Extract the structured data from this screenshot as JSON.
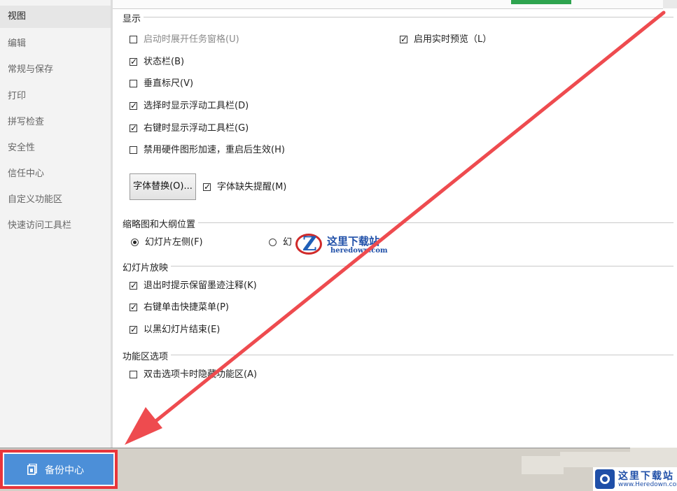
{
  "sidebar": {
    "items": [
      {
        "label": "视图",
        "active": true
      },
      {
        "label": "编辑"
      },
      {
        "label": "常规与保存"
      },
      {
        "label": "打印"
      },
      {
        "label": "拼写检查"
      },
      {
        "label": "安全性"
      },
      {
        "label": "信任中心"
      },
      {
        "label": "自定义功能区"
      },
      {
        "label": "快速访问工具栏"
      }
    ]
  },
  "sections": {
    "display": "显示",
    "thumbnail": "缩略图和大纲位置",
    "slideshow": "幻灯片放映",
    "ribbon": "功能区选项"
  },
  "options": {
    "startup_taskpane": {
      "label": "启动时展开任务窗格(U)",
      "checked": false,
      "disabled": true
    },
    "live_preview": {
      "label": "启用实时预览（L）",
      "checked": true
    },
    "status_bar": {
      "label": "状态栏(B)",
      "checked": true
    },
    "vertical_ruler": {
      "label": "垂直标尺(V)",
      "checked": false
    },
    "float_toolbar_select": {
      "label": "选择时显示浮动工具栏(D)",
      "checked": true
    },
    "float_toolbar_rightclick": {
      "label": "右键时显示浮动工具栏(G)",
      "checked": true
    },
    "disable_hw_accel": {
      "label": "禁用硬件图形加速，重启后生效(H)",
      "checked": false
    },
    "font_missing_alert": {
      "label": "字体缺失提醒(M)",
      "checked": true
    },
    "slides_left": {
      "label": "幻灯片左侧(F)",
      "selected": true
    },
    "slides_right_partial": {
      "label": "幻",
      "selected": false
    },
    "ink_prompt": {
      "label": "退出时提示保留墨迹注释(K)",
      "checked": true
    },
    "rightclick_menu": {
      "label": "右键单击快捷菜单(P)",
      "checked": true
    },
    "black_slide_end": {
      "label": "以黑幻灯片结束(E)",
      "checked": true
    },
    "dblclick_hide_ribbon": {
      "label": "双击选项卡时隐藏功能区(A)",
      "checked": false
    }
  },
  "buttons": {
    "font_replace": "字体替换(O)...",
    "backup_center": "备份中心"
  },
  "watermark": {
    "name": "这里下载站",
    "url": "heredown.com"
  },
  "brand": {
    "name": "这里下载站",
    "url": "www.Heredown.com"
  },
  "colors": {
    "accent_blue": "#4c8fd8",
    "highlight_red": "#e8353b",
    "green_button": "#2ea44f"
  },
  "icons": [
    "backup-icon",
    "arrow-annotation"
  ]
}
